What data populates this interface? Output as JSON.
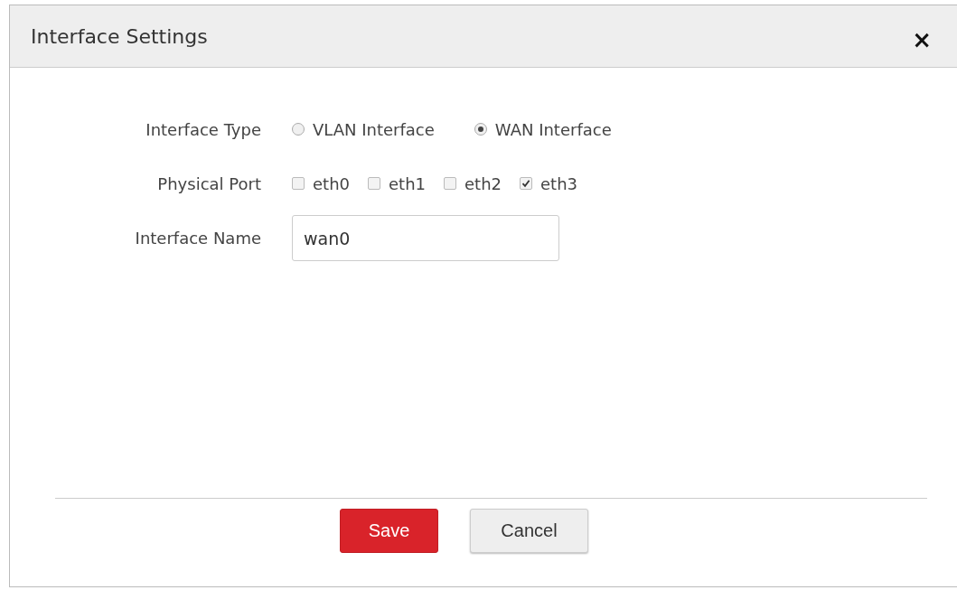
{
  "dialog": {
    "title": "Interface Settings",
    "close": "×"
  },
  "fields": [
    {
      "kind": "radio",
      "label": "Interface Type",
      "options": [
        {
          "label": "VLAN Interface",
          "selected": false
        },
        {
          "label": "WAN Interface",
          "selected": true
        }
      ]
    },
    {
      "kind": "checkbox",
      "label": "Physical Port",
      "options": [
        {
          "label": "eth0",
          "checked": false
        },
        {
          "label": "eth1",
          "checked": false
        },
        {
          "label": "eth2",
          "checked": false
        },
        {
          "label": "eth3",
          "checked": true
        }
      ]
    },
    {
      "kind": "text",
      "label": "Interface Name",
      "value": "wan0"
    }
  ],
  "buttons": [
    {
      "label": "Save",
      "kind": "primary"
    },
    {
      "label": "Cancel",
      "kind": "default"
    }
  ]
}
